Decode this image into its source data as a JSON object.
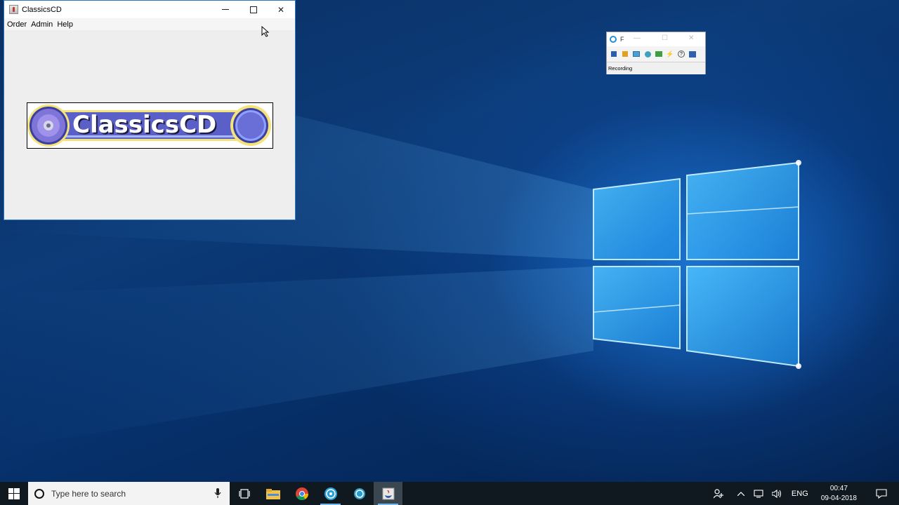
{
  "window": {
    "title": "ClassicsCD",
    "menu": [
      "Order",
      "Admin",
      "Help"
    ],
    "logo_text": "ClassicsCD"
  },
  "recorder": {
    "title": "F",
    "status": "Recording"
  },
  "taskbar": {
    "search_placeholder": "Type here to search",
    "language": "ENG",
    "time": "00:47",
    "date": "09-04-2018"
  },
  "colors": {
    "accent": "#2b76c2",
    "logo_band": "#5b5fc8",
    "logo_ring": "#f4e27a",
    "taskbar_bg": "#101820"
  },
  "icons": {
    "taskbar": [
      "windows-start-icon",
      "cortana-icon",
      "microphone-icon",
      "task-view-icon",
      "file-explorer-icon",
      "chrome-icon",
      "recorder-app-icon",
      "player-app-icon",
      "java-app-icon"
    ],
    "tray": [
      "people-icon",
      "chevron-up-icon",
      "network-icon",
      "volume-icon",
      "notification-icon"
    ]
  }
}
